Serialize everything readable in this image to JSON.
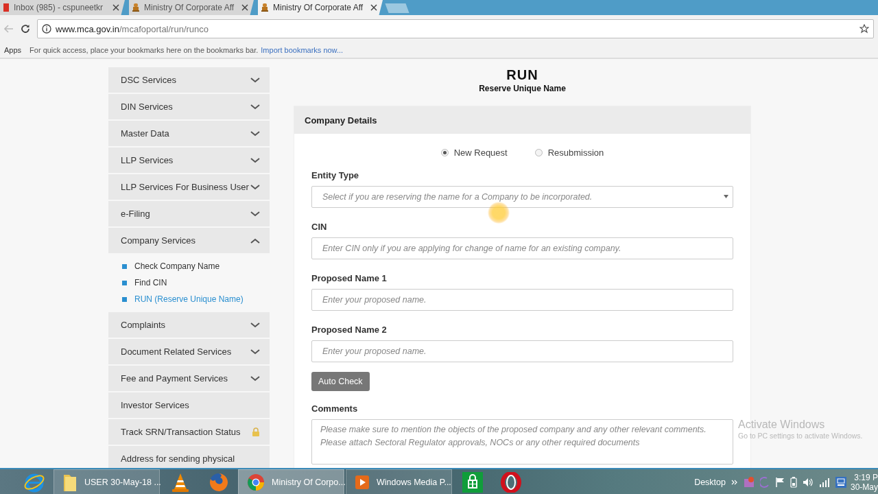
{
  "browser": {
    "tabs": [
      {
        "title": "Inbox (985) - cspuneetkr",
        "kind": "mail",
        "selected": false
      },
      {
        "title": "Ministry Of Corporate Aff",
        "kind": "emblem",
        "selected": false
      },
      {
        "title": "Ministry Of Corporate Aff",
        "kind": "emblem",
        "selected": true
      }
    ],
    "url_host": "www.mca.gov.in",
    "url_path": "/mcafoportal/run/runco",
    "bookmarks": {
      "apps": "Apps",
      "hint": "For quick access, place your bookmarks here on the bookmarks bar.",
      "import_link": "Import bookmarks now..."
    }
  },
  "sidebar": {
    "items": [
      {
        "label": "DSC Services",
        "kind": "menu",
        "expanded": false
      },
      {
        "label": "DIN Services",
        "kind": "menu",
        "expanded": false
      },
      {
        "label": "Master Data",
        "kind": "menu",
        "expanded": false
      },
      {
        "label": "LLP Services",
        "kind": "menu",
        "expanded": false
      },
      {
        "label": "LLP Services For Business User",
        "kind": "menu",
        "expanded": false
      },
      {
        "label": "e-Filing",
        "kind": "menu",
        "expanded": false
      },
      {
        "label": "Company Services",
        "kind": "menu",
        "expanded": true,
        "children": [
          {
            "label": "Check Company Name",
            "selected": false
          },
          {
            "label": "Find CIN",
            "selected": false
          },
          {
            "label": "RUN (Reserve Unique Name)",
            "selected": true
          }
        ]
      },
      {
        "label": "Complaints",
        "kind": "menu",
        "expanded": false
      },
      {
        "label": "Document Related Services",
        "kind": "menu",
        "expanded": false
      },
      {
        "label": "Fee and Payment Services",
        "kind": "menu",
        "expanded": false
      },
      {
        "label": "Investor Services",
        "kind": "link"
      },
      {
        "label": "Track SRN/Transaction Status",
        "kind": "locked"
      },
      {
        "label": "Address for sending physical",
        "kind": "link"
      }
    ]
  },
  "page": {
    "title": "RUN",
    "subtitle": "Reserve Unique Name",
    "card_title": "Company Details",
    "request_types": [
      {
        "label": "New Request",
        "selected": true
      },
      {
        "label": "Resubmission",
        "selected": false
      }
    ],
    "fields": [
      {
        "label": "Entity Type",
        "kind": "select",
        "placeholder": "Select if you are reserving the name for a Company to be incorporated."
      },
      {
        "label": "CIN",
        "kind": "text",
        "placeholder": "Enter CIN only if you are applying for change of name for an existing company."
      },
      {
        "label": "Proposed Name 1",
        "kind": "text",
        "placeholder": "Enter your proposed name."
      },
      {
        "label": "Proposed Name 2",
        "kind": "text",
        "placeholder": "Enter your proposed name."
      }
    ],
    "auto_check": "Auto Check",
    "comments": {
      "label": "Comments",
      "placeholder": "Please make sure to mention the objects of the proposed company and any other relevant comments. Please attach Sectoral Regulator approvals, NOCs or any other required documents"
    }
  },
  "activation_notice": {
    "title": "Activate Windows",
    "message": "Go to PC settings to activate Windows."
  },
  "taskbar": {
    "items": [
      {
        "kind": "ie",
        "selected": false
      },
      {
        "kind": "folder",
        "label": "USER 30-May-18 ...",
        "selected": false
      },
      {
        "kind": "vlc",
        "selected": false
      },
      {
        "kind": "firefox",
        "selected": false
      },
      {
        "kind": "chrome",
        "label": "Ministry Of Corpo...",
        "selected": true
      },
      {
        "kind": "media",
        "label": "Windows Media P...",
        "selected": false
      },
      {
        "kind": "store",
        "selected": false
      },
      {
        "kind": "opera",
        "selected": false
      }
    ],
    "toolbar_label": "Desktop",
    "clock": {
      "time": "3:19 P",
      "date": "30-May"
    }
  }
}
